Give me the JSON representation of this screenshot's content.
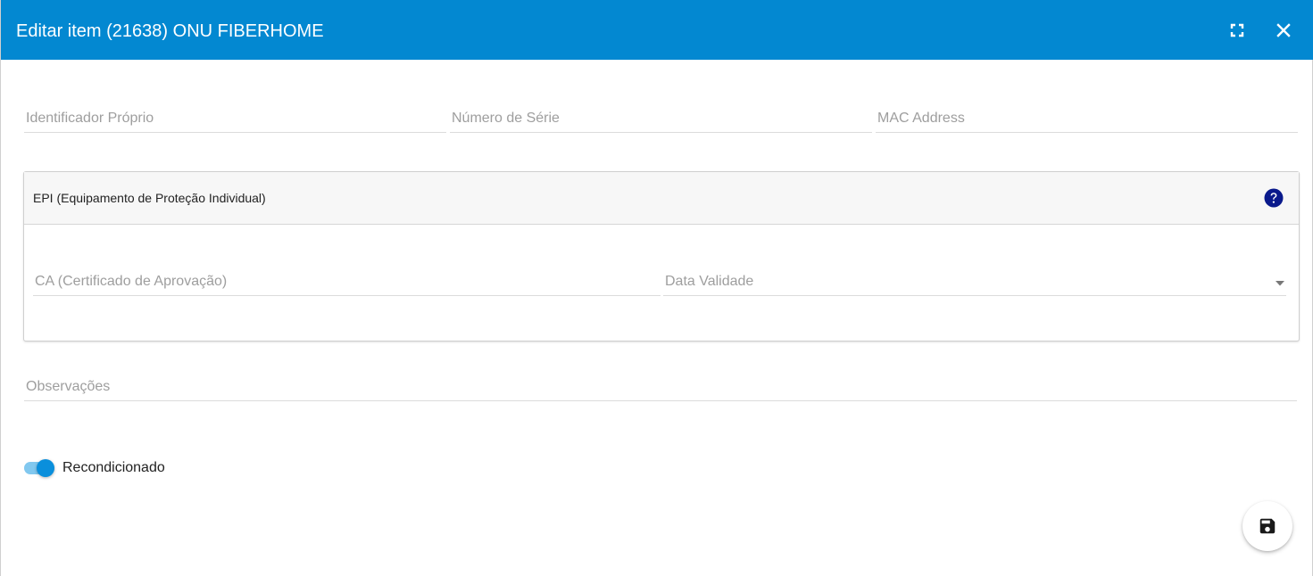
{
  "dialog": {
    "title": "Editar item (21638) ONU FIBERHOME",
    "header_color": "#0388d1"
  },
  "toolbar": {
    "fullscreen_icon": "fullscreen-icon",
    "close_icon": "close-icon"
  },
  "fields": {
    "identificador": {
      "placeholder": "Identificador Próprio",
      "value": ""
    },
    "numero_serie": {
      "placeholder": "Número de Série",
      "value": ""
    },
    "mac_address": {
      "placeholder": "MAC Address",
      "value": ""
    },
    "observacoes": {
      "placeholder": "Observações",
      "value": ""
    }
  },
  "epi_panel": {
    "title": "EPI (Equipamento de Proteção Individual)",
    "help_icon": "help-circle-icon",
    "ca": {
      "placeholder": "CA (Certificado de Aprovação)",
      "value": ""
    },
    "data_validade": {
      "placeholder": "Data Validade",
      "selected": ""
    }
  },
  "recondicionado": {
    "label": "Recondicionado",
    "checked": true
  },
  "save_button": {
    "icon": "save-icon"
  }
}
